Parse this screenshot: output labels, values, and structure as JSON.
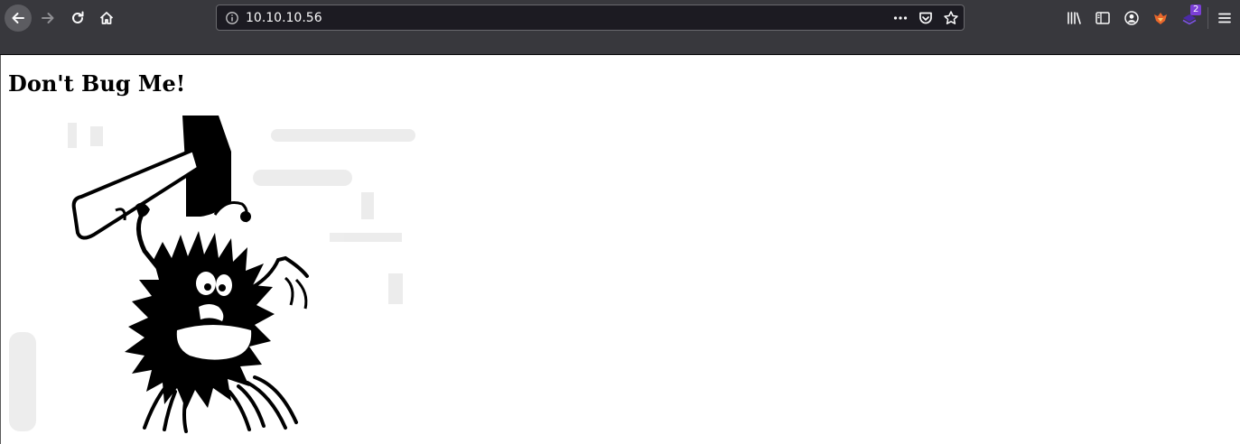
{
  "browser": {
    "url": "10.10.10.56",
    "icons": {
      "back": "back-arrow-icon",
      "forward": "forward-arrow-icon",
      "reload": "reload-icon",
      "home": "home-icon",
      "info": "info-icon",
      "page_actions": "more-dots-icon",
      "pocket": "pocket-icon",
      "bookmark": "star-icon",
      "library": "library-icon",
      "sidebar": "sidebar-icon",
      "account": "account-icon",
      "extension_fox": "fox-extension-icon",
      "extension_stack": "stack-extension-icon",
      "menu": "hamburger-menu-icon"
    },
    "extension_badge": "2",
    "colors": {
      "toolbar": "#38383d",
      "urlbar": "#1c1b22",
      "badge": "#7b3fd6"
    }
  },
  "page": {
    "heading": "Don't Bug Me!",
    "image": "bug-with-hammer-illustration"
  }
}
